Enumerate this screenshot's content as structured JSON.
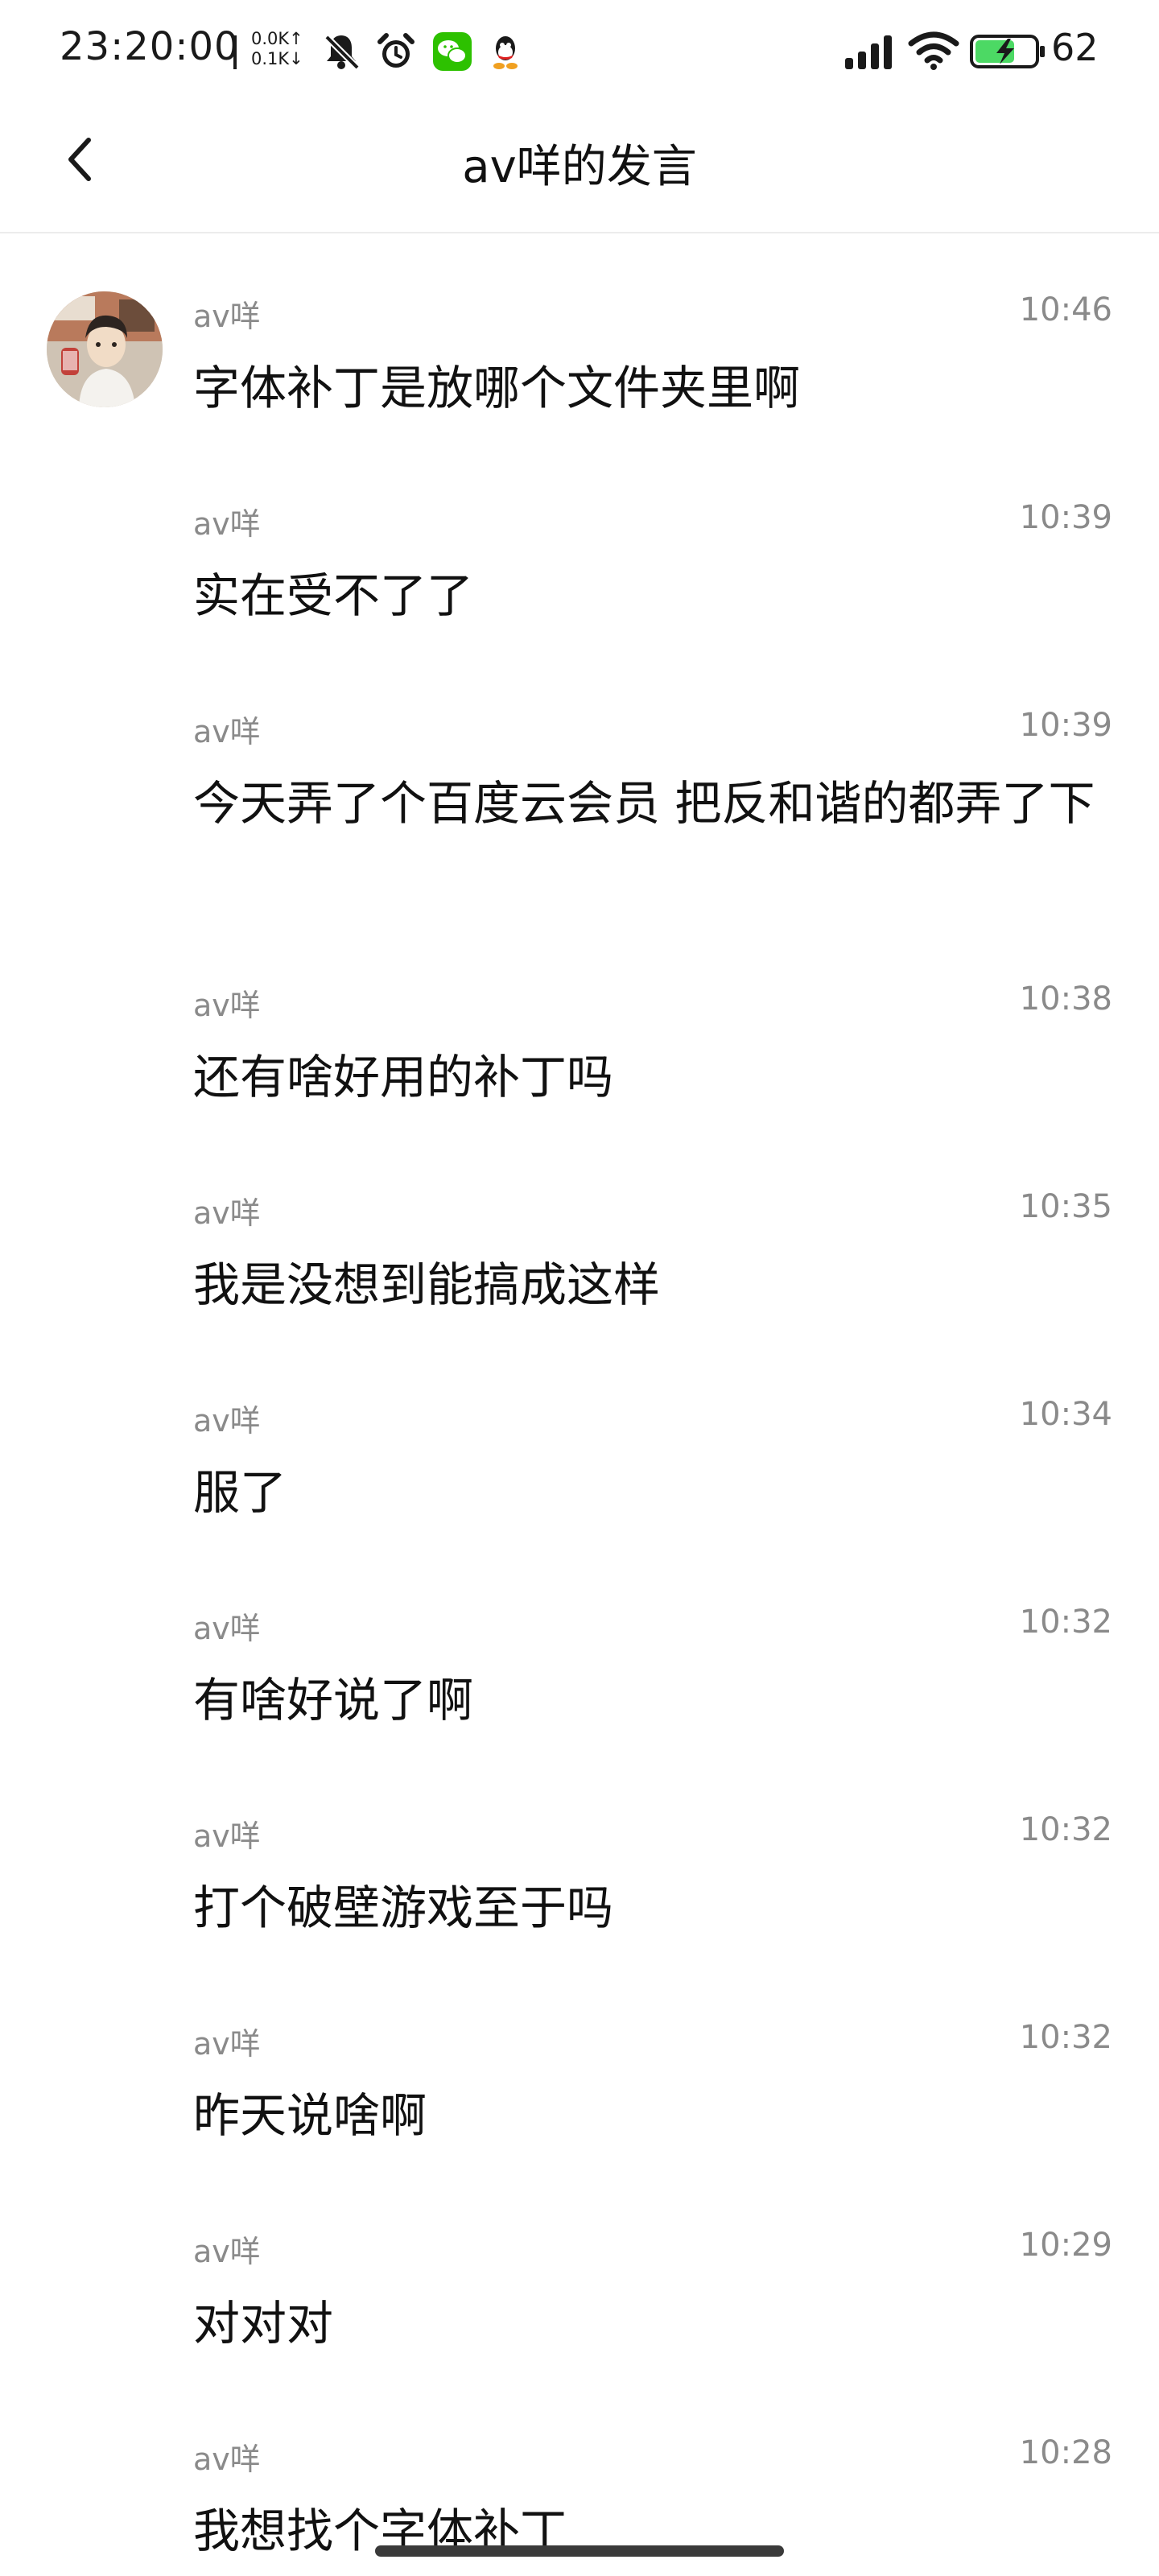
{
  "status_bar": {
    "time": "23:20:00",
    "net_up": "0.0K↑",
    "net_down": "0.1K↓",
    "battery": "62",
    "icons": [
      "bell-mute-icon",
      "alarm-icon",
      "wechat-icon",
      "qq-icon",
      "signal-icon",
      "wifi-icon",
      "battery-charging-icon"
    ],
    "colors": {
      "wechat": "#2dc100",
      "battery_fill": "#4cd964"
    }
  },
  "header": {
    "title": "av咩的发言",
    "back_icon": "chevron-left-icon"
  },
  "messages": [
    {
      "sender": "av咩",
      "time": "10:46",
      "text": "字体补丁是放哪个文件夹里啊"
    },
    {
      "sender": "av咩",
      "time": "10:39",
      "text": "实在受不了了"
    },
    {
      "sender": "av咩",
      "time": "10:39",
      "text": "今天弄了个百度云会员 把反和谐的都弄了下"
    },
    {
      "sender": "av咩",
      "time": "10:38",
      "text": "还有啥好用的补丁吗"
    },
    {
      "sender": "av咩",
      "time": "10:35",
      "text": "我是没想到能搞成这样"
    },
    {
      "sender": "av咩",
      "time": "10:34",
      "text": "服了"
    },
    {
      "sender": "av咩",
      "time": "10:32",
      "text": "有啥好说了啊"
    },
    {
      "sender": "av咩",
      "time": "10:32",
      "text": "打个破壁游戏至于吗"
    },
    {
      "sender": "av咩",
      "time": "10:32",
      "text": "昨天说啥啊"
    },
    {
      "sender": "av咩",
      "time": "10:29",
      "text": "对对对"
    },
    {
      "sender": "av咩",
      "time": "10:28",
      "text": "我想找个字体补丁"
    }
  ]
}
